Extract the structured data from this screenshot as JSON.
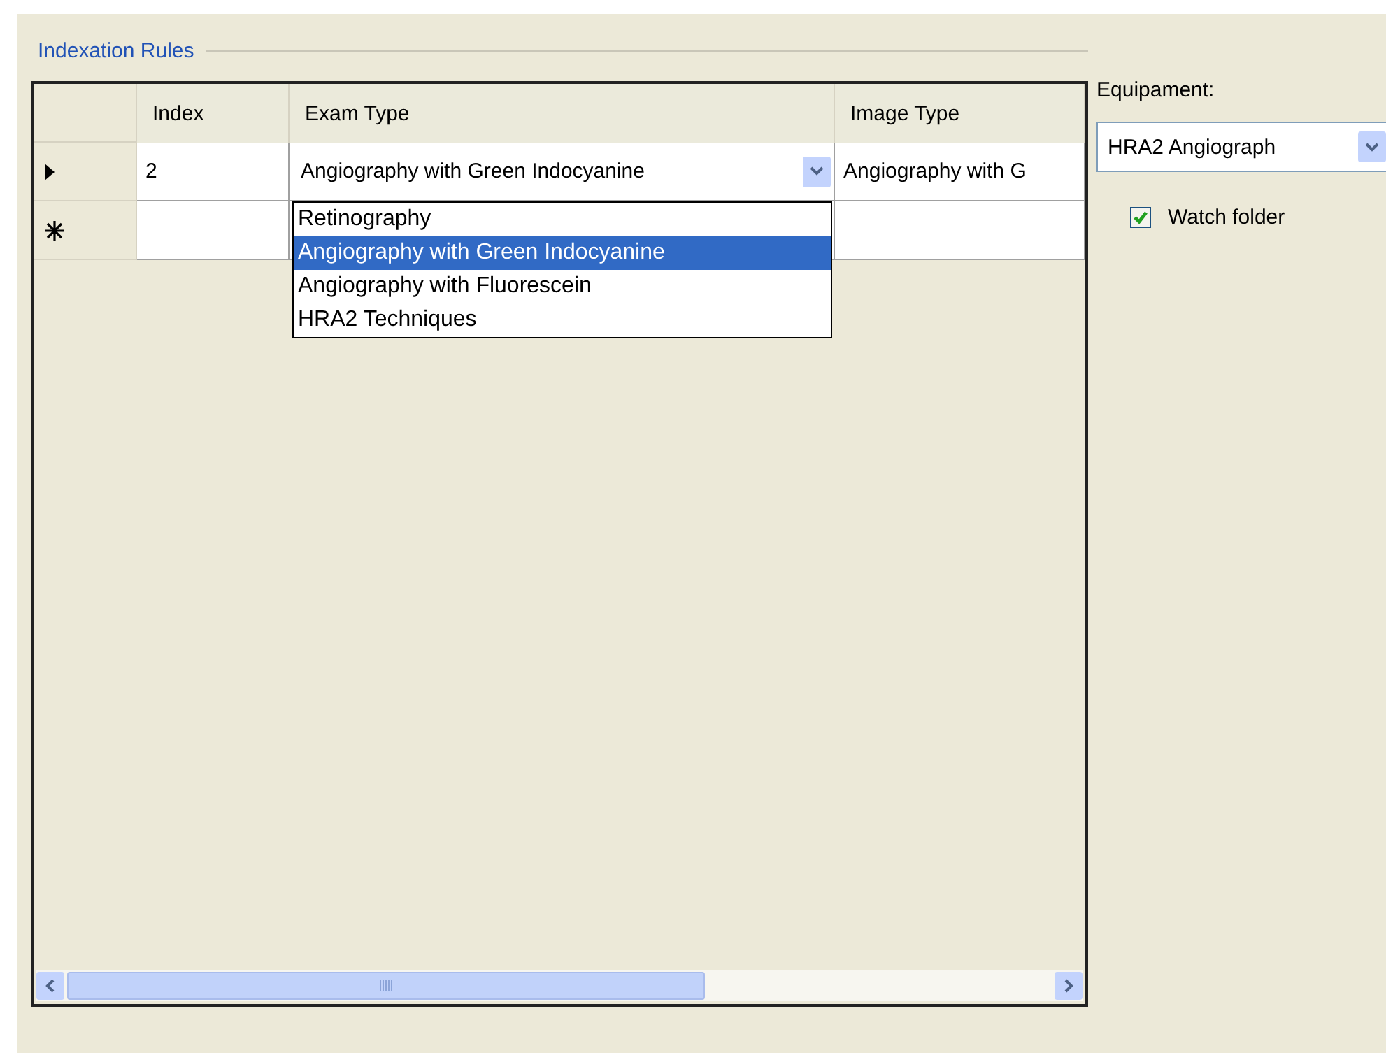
{
  "group": {
    "title": "Indexation Rules"
  },
  "grid": {
    "columns": [
      "Index",
      "Exam Type",
      "Image Type"
    ],
    "rows": [
      {
        "kind": "current",
        "index": "2",
        "exam_type": "Angiography with Green Indocyanine",
        "image_type": "Angiography with G"
      },
      {
        "kind": "new"
      }
    ]
  },
  "exam_dropdown": {
    "options": [
      {
        "label": "Retinography",
        "selected": false
      },
      {
        "label": "Angiography with Green Indocyanine",
        "selected": true
      },
      {
        "label": "Angiography with Fluorescein",
        "selected": false
      },
      {
        "label": "HRA2 Techniques",
        "selected": false
      }
    ]
  },
  "equipment": {
    "label": "Equipament:",
    "value": "HRA2 Angiograph"
  },
  "watch_folder": {
    "label": "Watch folder",
    "checked": true
  }
}
